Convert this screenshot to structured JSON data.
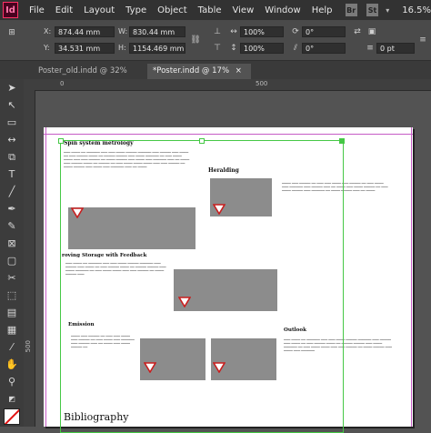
{
  "menubar": {
    "app_logo": "Id",
    "items": [
      "File",
      "Edit",
      "Layout",
      "Type",
      "Object",
      "Table",
      "View",
      "Window",
      "Help"
    ],
    "bridge_badge": "Br",
    "stock_badge": "St",
    "zoom": "16.5%"
  },
  "control": {
    "x_label": "X:",
    "x_value": "874.44 mm",
    "y_label": "Y:",
    "y_value": "34.531 mm",
    "w_label": "W:",
    "w_value": "830.44 mm",
    "h_label": "H:",
    "h_value": "1154.469 mm",
    "scale_x": "100%",
    "scale_y": "100%",
    "rotate": "0°",
    "shear": "0°",
    "stroke_weight": "0 pt",
    "opacity": "100%"
  },
  "tabs": [
    {
      "label": "Poster_old.indd @ 32%",
      "active": false
    },
    {
      "label": "*Poster.indd @ 17%",
      "active": true
    }
  ],
  "rulers": {
    "h_0": "0",
    "h_500": "500",
    "v_500": "500"
  },
  "document": {
    "spin_title": "Spin system metrology",
    "heralding_title": "Heralding",
    "storage_title": "roving Storage with Feedback",
    "emission_title": "Emission",
    "outlook_title": "Outlook",
    "bibliography_title": "Bibliography"
  }
}
